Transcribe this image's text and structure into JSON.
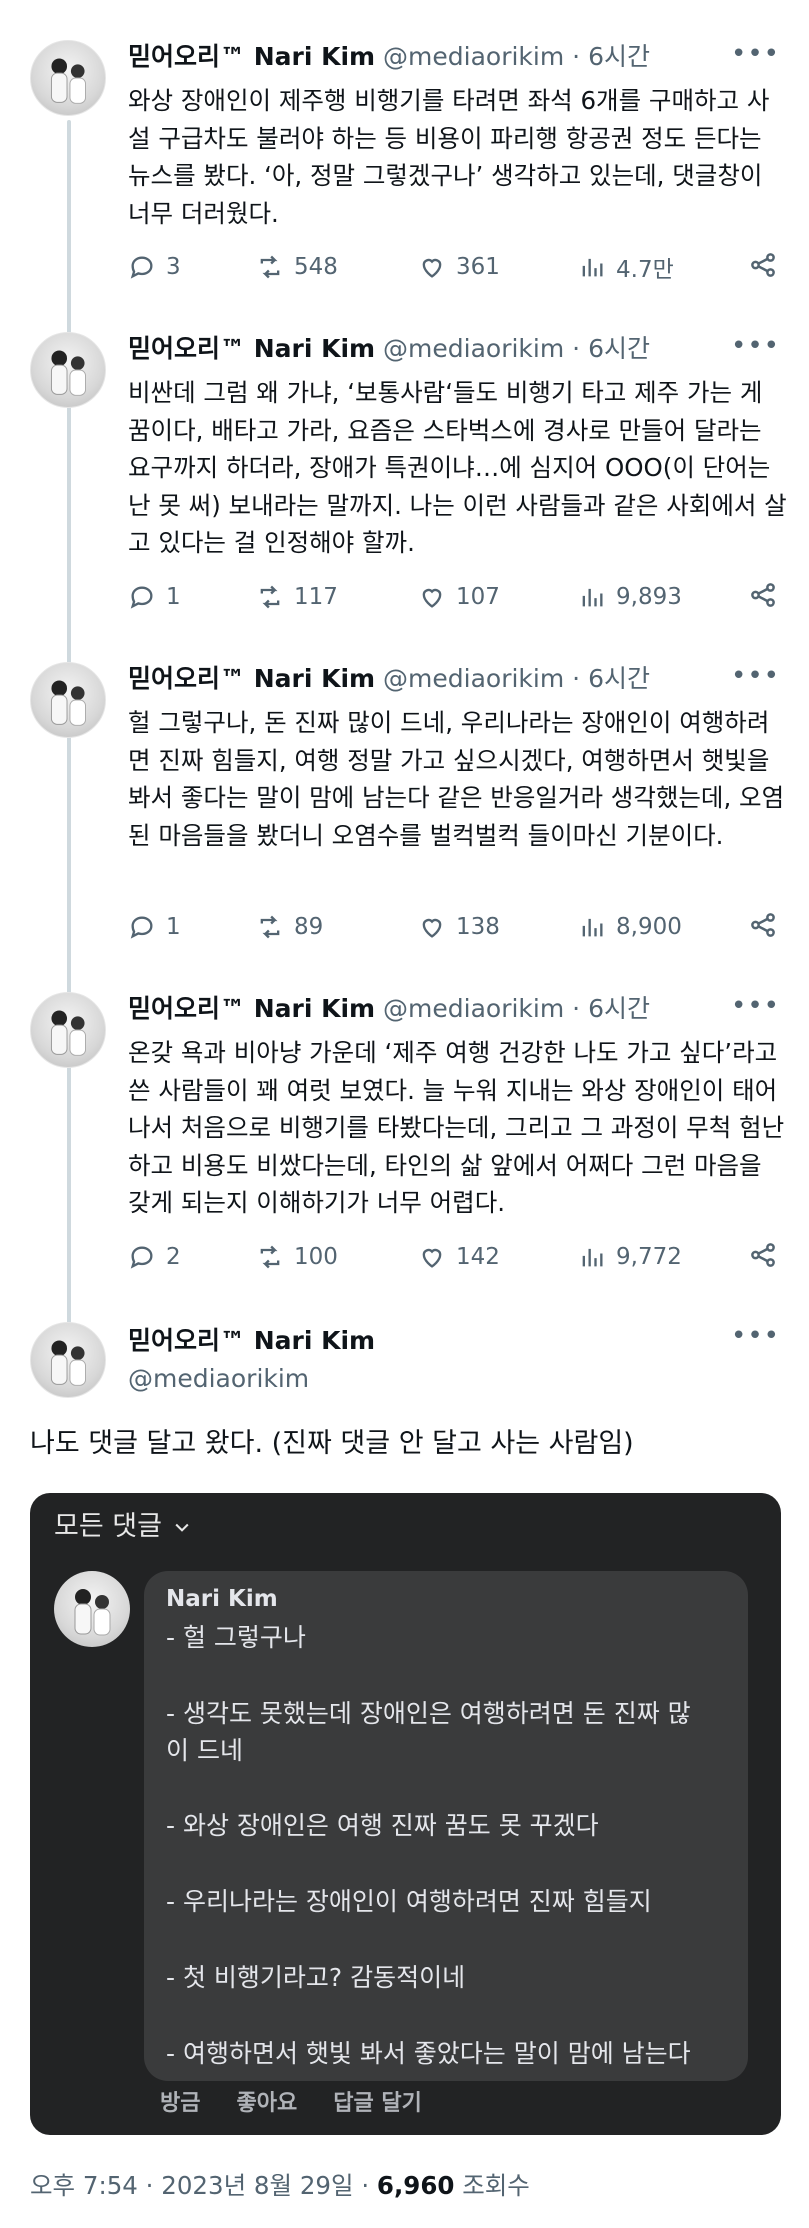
{
  "author": {
    "name": "믿어오리™ Nari Kim",
    "handle": "@mediaorikim",
    "time": "6시간",
    "dot": "·"
  },
  "tweets": [
    {
      "text": "와상 장애인이 제주행 비행기를 타려면 좌석 6개를 구매하고 사설 구급차도 불러야 하는 등 비용이 파리행 항공권 정도 든다는 뉴스를 봤다. ‘아, 정말 그렇겠구나’ 생각하고 있는데, 댓글창이 너무 더러웠다.",
      "replies": "3",
      "retweets": "548",
      "likes": "361",
      "views": "4.7만"
    },
    {
      "text": "비싼데 그럼 왜 가냐, ‘보통사람‘들도 비행기 타고 제주 가는 게 꿈이다, 배타고 가라, 요즘은 스타벅스에 경사로 만들어 달라는 요구까지 하더라, 장애가 특권이냐…에 심지어 OOO(이 단어는 난 못 써) 보내라는 말까지. 나는 이런 사람들과 같은 사회에서 살고 있다는 걸 인정해야 할까.",
      "replies": "1",
      "retweets": "117",
      "likes": "107",
      "views": "9,893"
    },
    {
      "text": "헐 그렇구나, 돈 진짜 많이 드네, 우리나라는 장애인이 여행하려면 진짜 힘들지, 여행 정말 가고 싶으시겠다, 여행하면서 햇빛을 봐서 좋다는 말이 맘에 남는다 같은 반응일거라 생각했는데, 오염된 마음들을 봤더니 오염수를 벌컥벌컥 들이마신 기분이다.",
      "replies": "1",
      "retweets": "89",
      "likes": "138",
      "views": "8,900"
    },
    {
      "text": "온갖 욕과 비아냥 가운데 ‘제주 여행 건강한 나도 가고 싶다’라고 쓴 사람들이 꽤 여럿 보였다. 늘 누워 지내는 와상 장애인이 태어나서 처음으로 비행기를 타봤다는데, 그리고 그 과정이 무척 험난하고 비용도 비쌌다는데, 타인의 삶 앞에서 어쩌다 그런 마음을 갖게 되는지 이해하기가 너무 어렵다.",
      "replies": "2",
      "retweets": "100",
      "likes": "142",
      "views": "9,772"
    }
  ],
  "main_tweet": {
    "text": "나도 댓글 달고 왔다. (진짜 댓글 안 달고 사는 사람임)"
  },
  "embedded": {
    "filter_label": "모든 댓글",
    "commenter": "Nari Kim",
    "lines": [
      "- 헐 그렇구나",
      "- 생각도 못했는데 장애인은 여행하려면 돈 진짜 많",
      "이 드네",
      "- 와상 장애인은 여행 진짜 꿈도 못 꾸겠다",
      "- 우리나라는 장애인이 여행하려면 진짜 힘들지",
      "- 첫 비행기라고? 감동적이네",
      "- 여행하면서 햇빛 봐서 좋았다는 말이 맘에 남는다"
    ],
    "actions": [
      "방금",
      "좋아요",
      "답글 달기"
    ]
  },
  "footer": {
    "timestamp": "오후 7:54 · 2023년 8월 29일 · ",
    "views_count": "6,960",
    "views_label": " 조회수"
  },
  "icons": {
    "reply": "reply-icon",
    "retweet": "retweet-icon",
    "like": "heart-icon",
    "views": "views-icon",
    "share": "share-icon",
    "more": "more-icon"
  },
  "colors": {
    "text": "#0f1419",
    "muted": "#536471",
    "thread_line": "#cfd9de",
    "card_bg": "#222324",
    "bubble_bg": "#3a3b3c"
  }
}
